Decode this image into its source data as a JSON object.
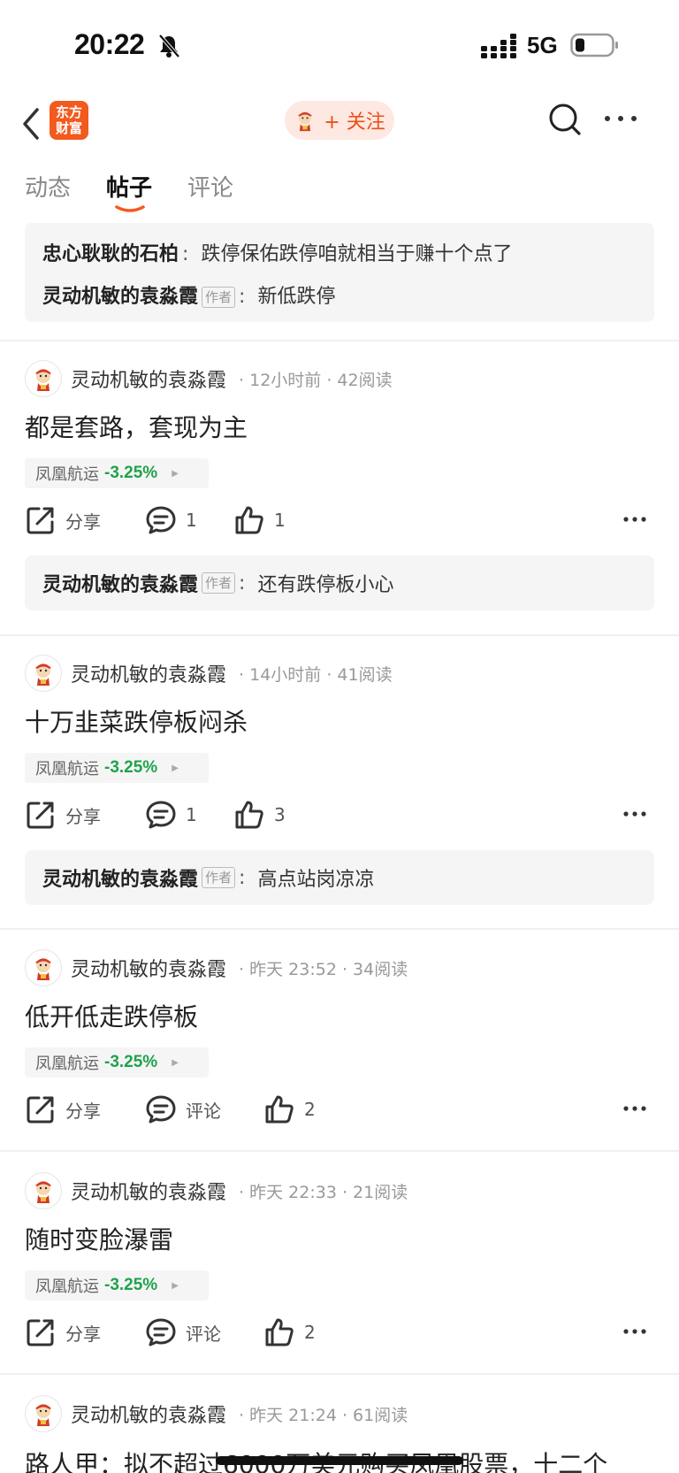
{
  "status": {
    "time": "20:22",
    "network": "5G"
  },
  "header": {
    "logo_line1": "东方",
    "logo_line2": "财富",
    "follow_label": "+ 关注"
  },
  "tabs": [
    {
      "label": "动态"
    },
    {
      "label": "帖子"
    },
    {
      "label": "评论"
    }
  ],
  "pinned": [
    {
      "user": "忠心耿耿的石柏",
      "text": "跌停保佑跌停咱就相当于赚十个点了"
    },
    {
      "user": "灵动机敏的袁淼霞",
      "author_tag": "作者",
      "text": "新低跌停"
    }
  ],
  "posts": [
    {
      "user": "灵动机敏的袁淼霞",
      "time": "12小时前",
      "reads": "42阅读",
      "title": "都是套路，套现为主",
      "stock": {
        "name": "凤凰航运",
        "change": "-3.25%"
      },
      "share": "分享",
      "comments": "1",
      "likes": "1",
      "reply": {
        "user": "灵动机敏的袁淼霞",
        "author_tag": "作者",
        "text": "还有跌停板小心"
      }
    },
    {
      "user": "灵动机敏的袁淼霞",
      "time": "14小时前",
      "reads": "41阅读",
      "title": "十万韭菜跌停板闷杀",
      "stock": {
        "name": "凤凰航运",
        "change": "-3.25%"
      },
      "share": "分享",
      "comments": "1",
      "likes": "3",
      "reply": {
        "user": "灵动机敏的袁淼霞",
        "author_tag": "作者",
        "text": "高点站岗凉凉"
      }
    },
    {
      "user": "灵动机敏的袁淼霞",
      "time": "昨天 23:52",
      "reads": "34阅读",
      "title": "低开低走跌停板",
      "stock": {
        "name": "凤凰航运",
        "change": "-3.25%"
      },
      "share": "分享",
      "comments": "评论",
      "likes": "2"
    },
    {
      "user": "灵动机敏的袁淼霞",
      "time": "昨天 22:33",
      "reads": "21阅读",
      "title": "随时变脸瀑雷",
      "stock": {
        "name": "凤凰航运",
        "change": "-3.25%"
      },
      "share": "分享",
      "comments": "评论",
      "likes": "2"
    },
    {
      "user": "灵动机敏的袁淼霞",
      "time": "昨天 21:24",
      "reads": "61阅读",
      "title": "路人甲：拟不超过6000万美元购买凤凰股票，十二个"
    }
  ],
  "icons": {
    "back": "chevron-left-icon",
    "search": "search-icon",
    "more": "more-horizontal-icon",
    "share": "share-icon",
    "comment": "comment-icon",
    "like": "thumbs-up-icon",
    "bell": "bell-muted-icon",
    "signal": "signal-icon",
    "battery": "battery-icon"
  },
  "colors": {
    "brand": "#f35a1e",
    "follow_bg": "#fde9e2",
    "stock_down": "#1fa34a",
    "panel_bg": "#f5f5f6"
  }
}
